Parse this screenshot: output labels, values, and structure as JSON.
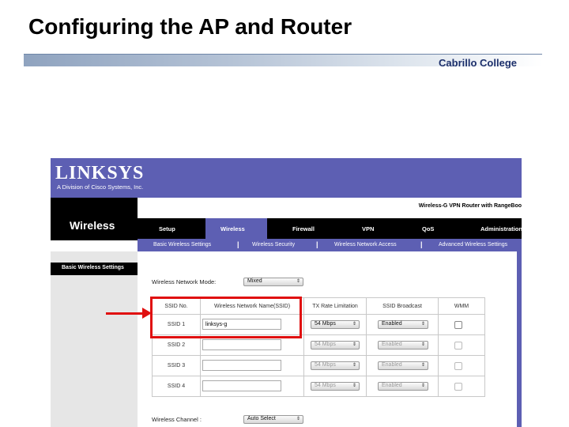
{
  "slide": {
    "title": "Configuring the AP and Router",
    "college": "Cabrillo College"
  },
  "router_ui": {
    "brand": "LINKSYS",
    "brand_sub": "A Division of Cisco Systems, Inc.",
    "model": "Wireless-G VPN Router with RangeBoo",
    "section": "Wireless",
    "main_tabs": [
      "Setup",
      "Wireless",
      "Firewall",
      "VPN",
      "QoS",
      "Administration"
    ],
    "active_tab": "Wireless",
    "sub_tabs": [
      "Basic Wireless Settings",
      "Wireless Security",
      "Wireless Network Access",
      "Advanced Wireless Settings"
    ],
    "sidebar_heading": "Basic Wireless Settings",
    "mode_label": "Wireless Network Mode:",
    "mode_value": "Mixed",
    "table_headers": [
      "SSID No.",
      "Wireless Network Name(SSID)",
      "TX Rate Limitation",
      "SSID Broadcast",
      "WMM"
    ],
    "rows": [
      {
        "no": "SSID 1",
        "name": "linksys-g",
        "rate": "54 Mbps",
        "broadcast": "Enabled",
        "wmm": false
      },
      {
        "no": "SSID 2",
        "name": "",
        "rate": "54 Mbps",
        "broadcast": "Enabled",
        "wmm": false
      },
      {
        "no": "SSID 3",
        "name": "",
        "rate": "54 Mbps",
        "broadcast": "Enabled",
        "wmm": false
      },
      {
        "no": "SSID 4",
        "name": "",
        "rate": "54 Mbps",
        "broadcast": "Enabled",
        "wmm": false
      }
    ],
    "channel_label": "Wireless Channel :",
    "channel_value": "Auto Select"
  },
  "colors": {
    "brand_purple": "#5d5fb3",
    "highlight_red": "#e01010"
  }
}
